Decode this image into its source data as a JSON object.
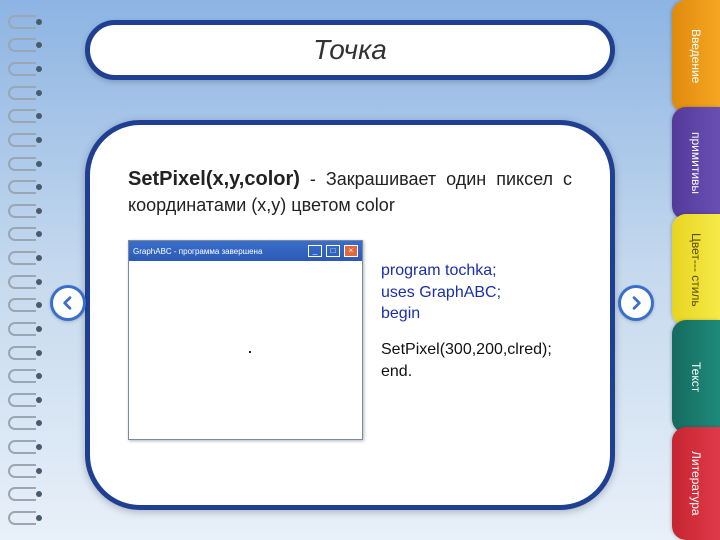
{
  "title": "Точка",
  "desc": {
    "function": "SetPixel(x,y,color)",
    "text": " - Закрашивает один пиксел с координатами (x,y) цветом color"
  },
  "screenshot": {
    "title": "GraphABC - программа завершена"
  },
  "code": {
    "l1": "program tochka;",
    "l2": "uses GraphABC;",
    "l3": "begin",
    "l4": "SetPixel(300,200,clred);",
    "l5": "end."
  },
  "tabs": {
    "t1": "Введение",
    "t2": "примитивы",
    "t3": "Цвет--- стиль",
    "t4": "Текст",
    "t5": "Литература"
  }
}
